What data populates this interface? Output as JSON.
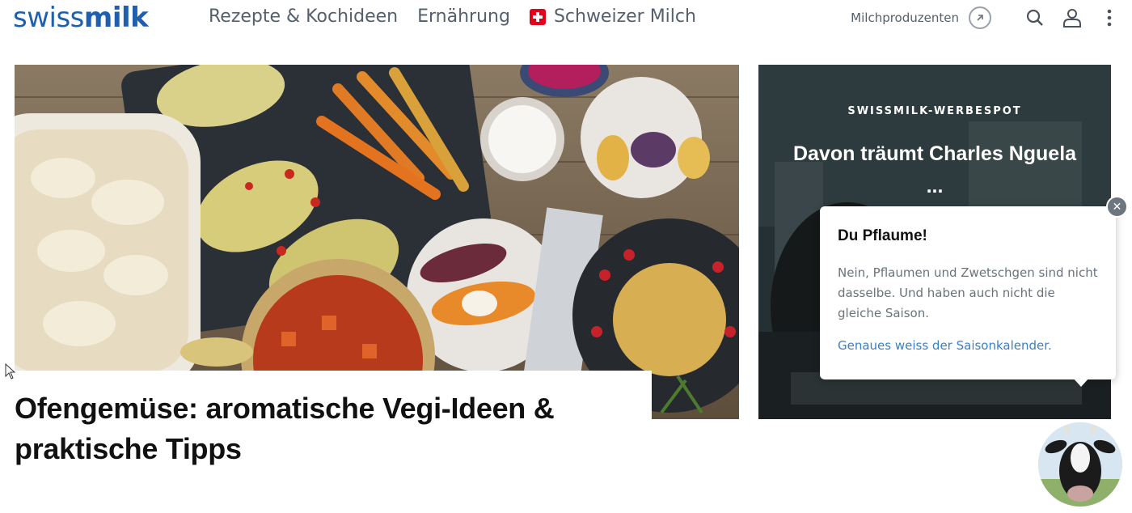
{
  "header": {
    "logo_part1": "swiss",
    "logo_part2": "milk",
    "nav": [
      {
        "label": "Rezepte & Kochideen"
      },
      {
        "label": "Ernährung"
      },
      {
        "label": "Schweizer Milch",
        "icon": "swiss-flag-icon"
      }
    ],
    "producers_link": "Milchproduzenten",
    "icons": [
      "external-link-icon",
      "search-icon",
      "user-icon",
      "more-vertical-icon"
    ]
  },
  "hero": {
    "image": "oven-roasted-vegetables-photo",
    "title": "Ofengemüse: aromatische Vegi-Ideen & praktische Tipps"
  },
  "promo": {
    "kicker": "SWISSMILK-WERBESPOT",
    "title": "Davon träumt Charles Nguela ..."
  },
  "tooltip": {
    "title": "Du Pflaume!",
    "text": "Nein, Pflaumen und Zwetschgen sind nicht dasselbe. Und haben auch nicht die gleiche Saison.",
    "link": "Genaues weiss der Saisonkalender.",
    "close_icon": "close-icon"
  },
  "colors": {
    "brand_blue": "#1f5fb0",
    "nav_gray": "#56606c",
    "link_blue": "#3b7fc4",
    "swiss_red": "#e2001a"
  }
}
